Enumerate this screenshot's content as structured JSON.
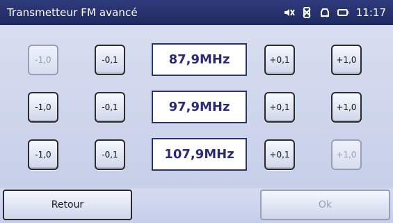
{
  "header": {
    "title": "Transmetteur FM avancé",
    "time": "11:17"
  },
  "status_icons": [
    "mute-icon",
    "phone-disabled-icon",
    "car-icon",
    "battery-icon"
  ],
  "rows": [
    {
      "minus_10": "-1,0",
      "minus_01": "-0,1",
      "freq": "87,9MHz",
      "plus_01": "+0,1",
      "plus_10": "+1,0"
    },
    {
      "minus_10": "-1,0",
      "minus_01": "-0,1",
      "freq": "97,9MHz",
      "plus_01": "+0,1",
      "plus_10": "+1,0"
    },
    {
      "minus_10": "-1,0",
      "minus_01": "-0,1",
      "freq": "107,9MHz",
      "plus_01": "+0,1",
      "plus_10": "+1,0"
    }
  ],
  "footer": {
    "back_label": "Retour",
    "ok_label": "Ok"
  }
}
